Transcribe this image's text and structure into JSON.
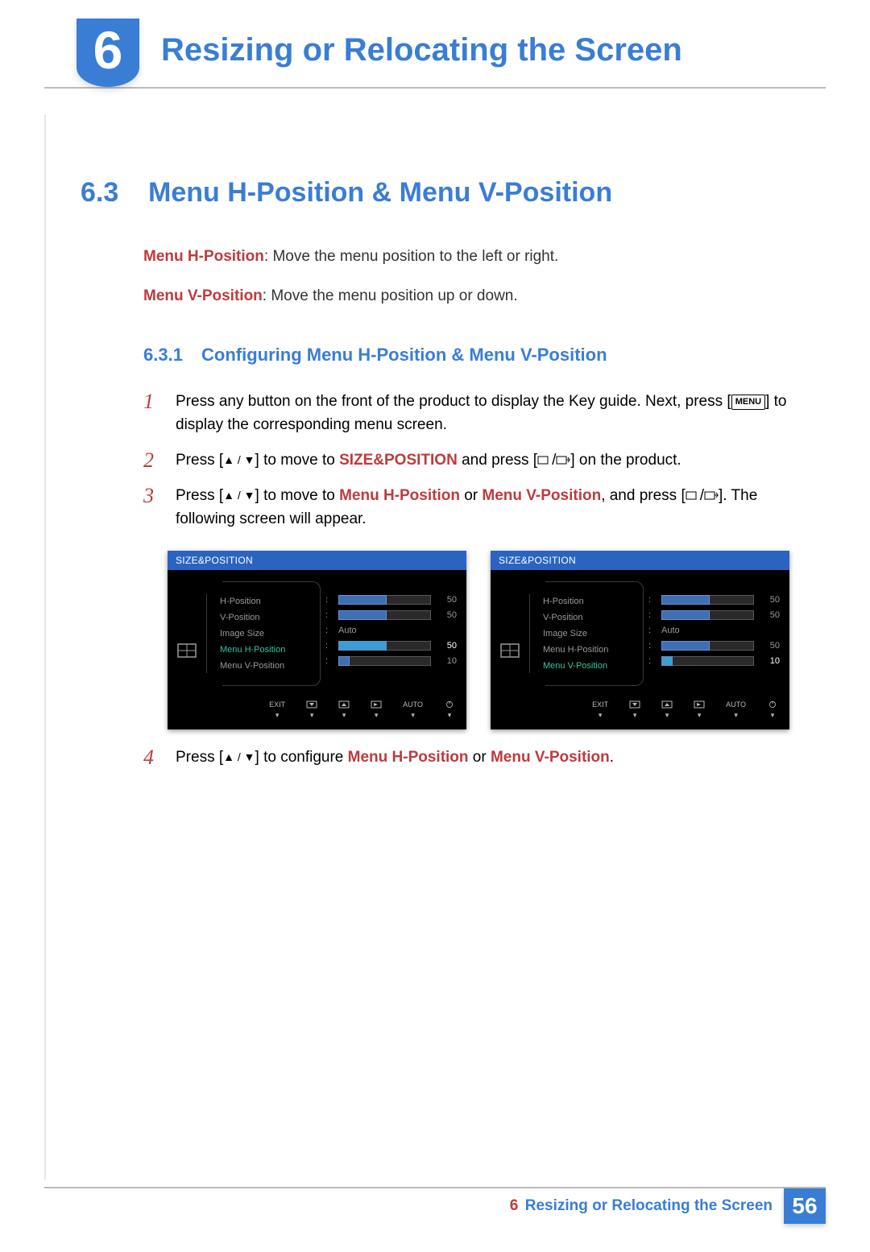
{
  "chapter_number": "6",
  "chapter_title": "Resizing or Relocating the Screen",
  "section": {
    "num": "6.3",
    "title": "Menu H-Position & Menu V-Position"
  },
  "para1_term": "Menu H-Position",
  "para1_rest": ": Move the menu position to the left or right.",
  "para2_term": "Menu V-Position",
  "para2_rest": ": Move the menu position up or down.",
  "subsection": {
    "num": "6.3.1",
    "title": "Configuring Menu H-Position & Menu V-Position"
  },
  "kbd_menu": "MENU",
  "size_pos_label": "SIZE&POSITION",
  "menu_h_label": "Menu H-Position",
  "menu_v_label": "Menu V-Position",
  "steps": [
    {
      "n": "1",
      "pre": "Press any button on the front of the product to display the Key guide. Next, press [",
      "post": "] to display the corresponding menu screen."
    },
    {
      "n": "2",
      "pre": "Press [",
      "mid": "] to move to ",
      "post2": " and press [",
      "end": "] on the product."
    },
    {
      "n": "3",
      "pre": "Press [",
      "mid": "] to move to ",
      "or": " or ",
      "post2": ", and press [",
      "end": "]. The following screen will appear."
    },
    {
      "n": "4",
      "pre": "Press [",
      "mid": "] to configure ",
      "or": " or ",
      "end": "."
    }
  ],
  "osd": {
    "header": "SIZE&POSITION",
    "items": [
      "H-Position",
      "V-Position",
      "Image Size",
      "Menu H-Position",
      "Menu V-Position"
    ],
    "auto": "Auto",
    "values": {
      "h": 50,
      "v": 50,
      "mh": 50,
      "mv": 10
    },
    "buttons": [
      "EXIT",
      "",
      "",
      "",
      "AUTO",
      ""
    ]
  },
  "footer": {
    "chapter": "6",
    "title": "Resizing or Relocating the Screen",
    "page": "56"
  }
}
